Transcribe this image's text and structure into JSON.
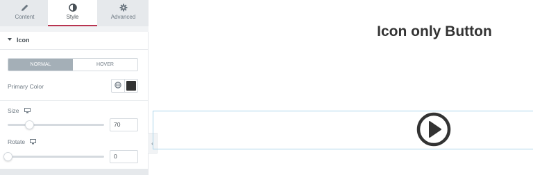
{
  "panel": {
    "tabs": [
      {
        "label": "Content",
        "icon": "pencil-icon",
        "active": false
      },
      {
        "label": "Style",
        "icon": "half-circle-icon",
        "active": true
      },
      {
        "label": "Advanced",
        "icon": "gear-icon",
        "active": false
      }
    ],
    "accent_color": "#b83450",
    "section": {
      "title": "Icon",
      "expanded": true
    },
    "state_switch": {
      "normal": "NORMAL",
      "hover": "HOVER",
      "selected": "NORMAL"
    },
    "primary_color": {
      "label": "Primary Color",
      "value": "#333333"
    },
    "size": {
      "label": "Size",
      "value": "70",
      "slider_fraction": 0.22
    },
    "rotate": {
      "label": "Rotate",
      "value": "0",
      "slider_fraction": 0.0
    }
  },
  "preview": {
    "heading": "Icon only Button",
    "button_icon": "play-circle-icon",
    "selection_border_color": "#a9d4ea"
  }
}
